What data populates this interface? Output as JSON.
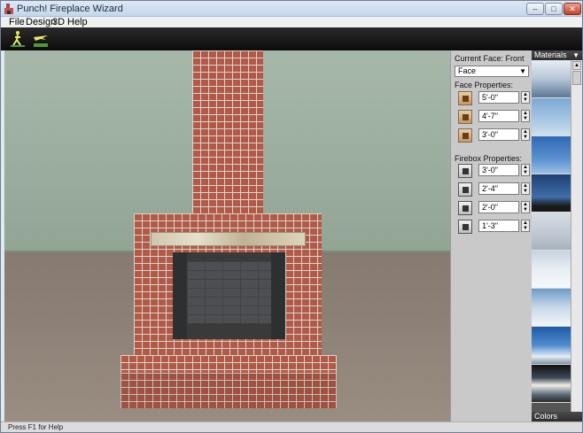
{
  "window": {
    "title": "Punch! Fireplace Wizard",
    "minimize": "–",
    "maximize": "□",
    "close": "✕"
  },
  "menu": [
    "File",
    "Design",
    "3D",
    "Help"
  ],
  "toolbar": {
    "buttons": [
      {
        "icon": "walk-through-icon"
      },
      {
        "icon": "fly-over-icon"
      }
    ]
  },
  "panel": {
    "current_face_label": "Current Face: Front",
    "face_select_value": "Face",
    "face_properties_label": "Face Properties:",
    "face_properties": [
      "5'-0\"",
      "4'-7\"",
      "3'-0\""
    ],
    "firebox_properties_label": "Firebox Properties:",
    "firebox_properties": [
      "3'-0\"",
      "2'-4\"",
      "2'-0\"",
      "1'-3\""
    ]
  },
  "materials": {
    "header": "Materials",
    "footer": "Colors"
  },
  "status": {
    "text": "Press F1 for Help"
  }
}
